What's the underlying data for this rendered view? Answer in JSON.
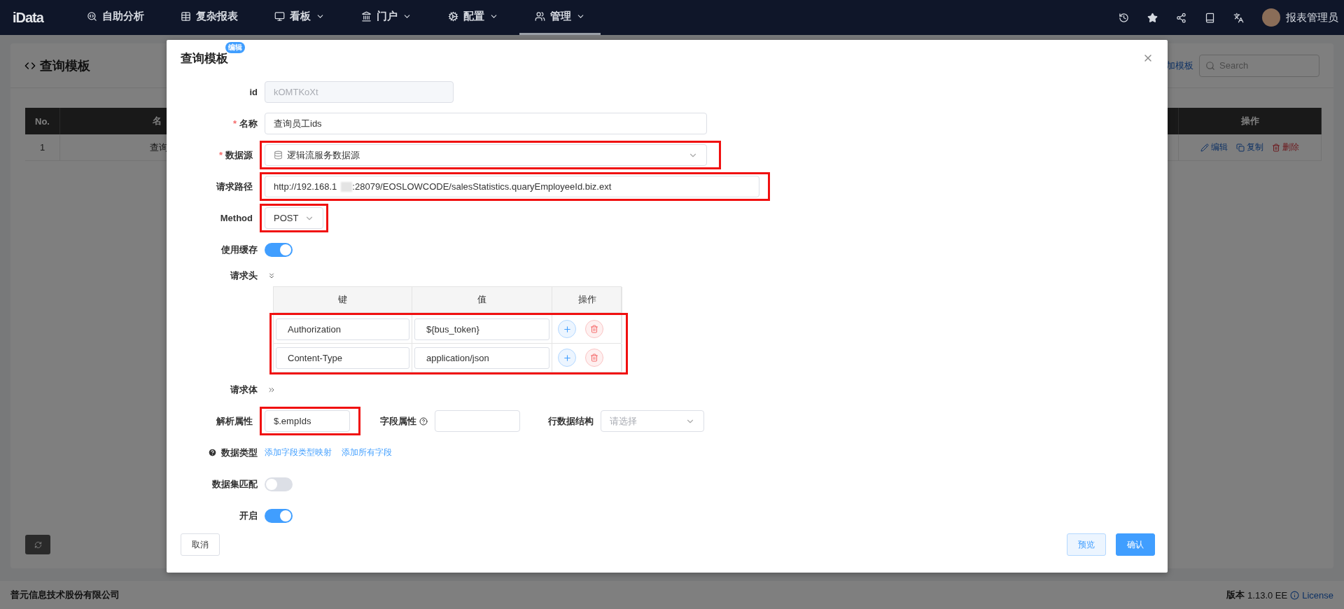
{
  "nav": {
    "logo": "iData",
    "items": [
      {
        "label": "自助分析",
        "dropdown": false,
        "selected": false
      },
      {
        "label": "复杂报表",
        "dropdown": false,
        "selected": false
      },
      {
        "label": "看板",
        "dropdown": true,
        "selected": false
      },
      {
        "label": "门户",
        "dropdown": true,
        "selected": false
      },
      {
        "label": "配置",
        "dropdown": true,
        "selected": false
      },
      {
        "label": "管理",
        "dropdown": true,
        "selected": true
      }
    ],
    "user": "报表管理员"
  },
  "page": {
    "title": "查询模板",
    "add_link": "加模板",
    "search": {
      "placeholder": "Search"
    },
    "table": {
      "columns": [
        "No.",
        "名",
        "操作"
      ],
      "rows": [
        {
          "no": "1",
          "name": "查询",
          "actions": [
            "编辑",
            "复制",
            "删除"
          ]
        }
      ]
    }
  },
  "dialog": {
    "title": "查询模板",
    "badge": "编辑",
    "id": {
      "label": "id",
      "value": "kOMTKoXt",
      "disabled": true
    },
    "name": {
      "label": "名称",
      "required_mark": "*",
      "value": "查询员工ids"
    },
    "datasource": {
      "label": "数据源",
      "required_mark": "*",
      "value": "逻辑流服务数据源",
      "highlighted": true
    },
    "path": {
      "label": "请求路径",
      "before": "http://192.168.1",
      "after": ":28079/EOSLOWCODE/salesStatistics.quaryEmployeeId.biz.ext",
      "redacted": true,
      "highlighted": true
    },
    "method": {
      "label": "Method",
      "value": "POST",
      "highlighted": true
    },
    "cache": {
      "label": "使用缓存",
      "on": true
    },
    "headers": {
      "label": "请求头",
      "expanded": true,
      "columns": [
        "键",
        "值",
        "操作"
      ],
      "highlighted": true,
      "rows": [
        {
          "key": "Authorization",
          "value": "${bus_token}"
        },
        {
          "key": "Content-Type",
          "value": "application/json"
        }
      ]
    },
    "body": {
      "label": "请求体",
      "expanded": false
    },
    "parse": {
      "label": "解析属性",
      "value": "$.empIds",
      "highlighted": true
    },
    "field_attr": {
      "label": "字段属性"
    },
    "row_structure": {
      "label": "行数据结构",
      "placeholder": "请选择"
    },
    "data_type": {
      "label": "数据类型",
      "links": [
        "添加字段类型映射",
        "添加所有字段"
      ]
    },
    "dataset_match": {
      "label": "数据集匹配",
      "on": false
    },
    "enabled": {
      "label": "开启",
      "on": true
    },
    "buttons": {
      "cancel": "取消",
      "preview": "预览",
      "confirm": "确认"
    }
  },
  "footer": {
    "company": "普元信息技术股份有限公司",
    "version_label": "版本",
    "version": "1.13.0 EE",
    "license": "License"
  }
}
